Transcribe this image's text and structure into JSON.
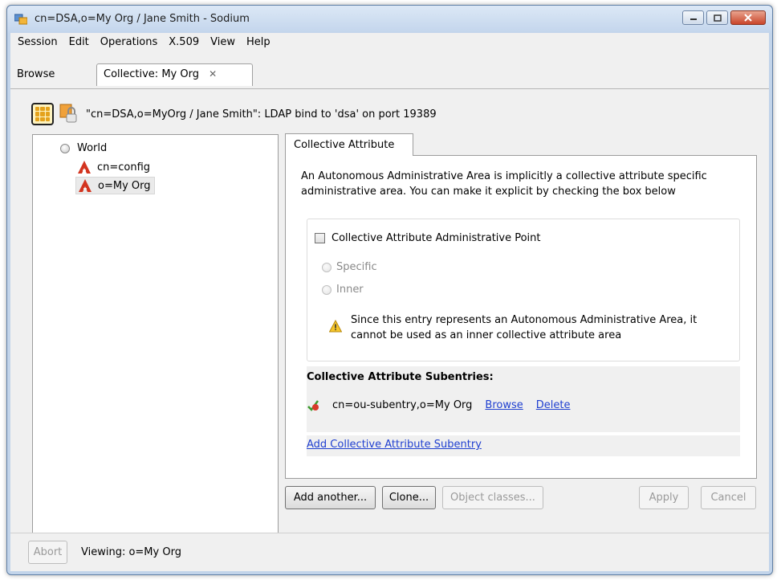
{
  "window": {
    "title": "cn=DSA,o=My Org / Jane Smith - Sodium"
  },
  "menubar": {
    "items": [
      "Session",
      "Edit",
      "Operations",
      "X.509",
      "View",
      "Help"
    ]
  },
  "tabs": {
    "browse": "Browse",
    "active": "Collective: My Org"
  },
  "connection": {
    "text": "\"cn=DSA,o=MyOrg / Jane Smith\": LDAP bind to 'dsa' on port 19389"
  },
  "tree": {
    "root": "World",
    "items": [
      "cn=config",
      "o=My Org"
    ]
  },
  "panel": {
    "tab": "Collective Attribute",
    "description": "An Autonomous Administrative Area is implicitly a collective attribute specific administrative area. You can make it explicit by checking the box below",
    "checkbox_label": "Collective Attribute Administrative Point",
    "checkbox_checked": false,
    "radio_specific": "Specific",
    "radio_inner": "Inner",
    "warning": "Since this entry represents an Autonomous Administrative Area, it cannot be used as an inner collective attribute area",
    "subentries_title": "Collective Attribute Subentries:",
    "subentry": {
      "dn": "cn=ou-subentry,o=My Org",
      "browse": "Browse",
      "delete": "Delete"
    },
    "add_subentry": "Add Collective Attribute Subentry"
  },
  "buttons": {
    "add_another": "Add another...",
    "clone": "Clone...",
    "object_classes": "Object classes...",
    "apply": "Apply",
    "cancel": "Cancel"
  },
  "status": {
    "abort": "Abort",
    "text": "Viewing: o=My Org"
  },
  "colors": {
    "accent_link": "#1f3fd0",
    "window_frame": "#c2d4ea",
    "close_button": "#c9452a"
  },
  "icons": [
    "app-icon",
    "minimize-icon",
    "maximize-icon",
    "close-icon",
    "server-grid-icon",
    "lock-icon",
    "radio-icon",
    "entry-a-icon",
    "warning-icon",
    "subentry-icon"
  ]
}
